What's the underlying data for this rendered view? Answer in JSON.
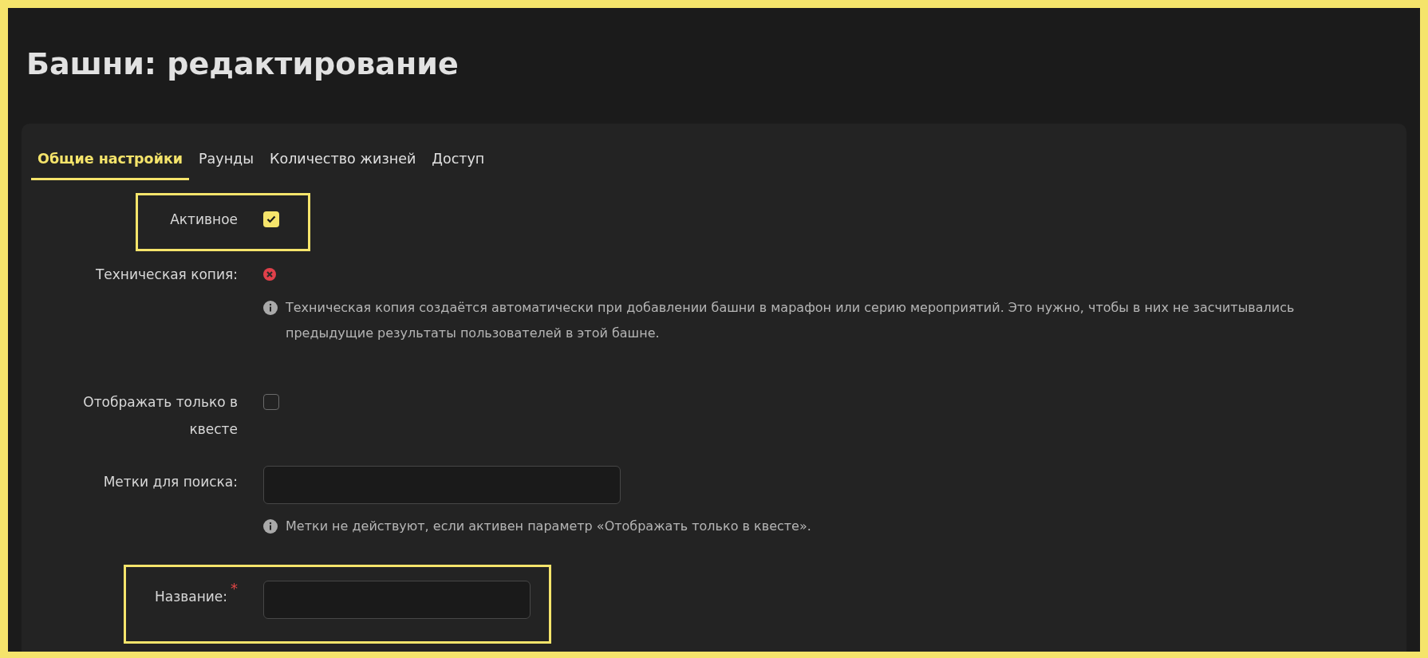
{
  "page_title": "Башни: редактирование",
  "tabs": [
    {
      "label": "Общие настройки",
      "selected": true
    },
    {
      "label": "Раунды",
      "selected": false
    },
    {
      "label": "Количество жизней",
      "selected": false
    },
    {
      "label": "Доступ",
      "selected": false
    }
  ],
  "fields": [
    {
      "kind": "checkbox",
      "label": "Активное",
      "checked": true,
      "highlighted": true
    },
    {
      "kind": "status",
      "label": "Техническая копия:",
      "on": false,
      "hint": "Техническая копия создаётся автоматически при добавлении башни в марафон или серию мероприятий. Это нужно, чтобы в них не засчитывались предыдущие результаты пользователей в этой башне."
    },
    {
      "kind": "checkbox",
      "label": "Отображать только в квесте",
      "checked": false,
      "highlighted": false
    },
    {
      "kind": "text",
      "label": "Метки для поиска:",
      "highlighted": false,
      "hint": "Метки не действуют, если активен параметр «Отображать только в квесте»."
    },
    {
      "kind": "text",
      "label": "Название:",
      "required_mark": "*",
      "highlighted": true
    }
  ]
}
